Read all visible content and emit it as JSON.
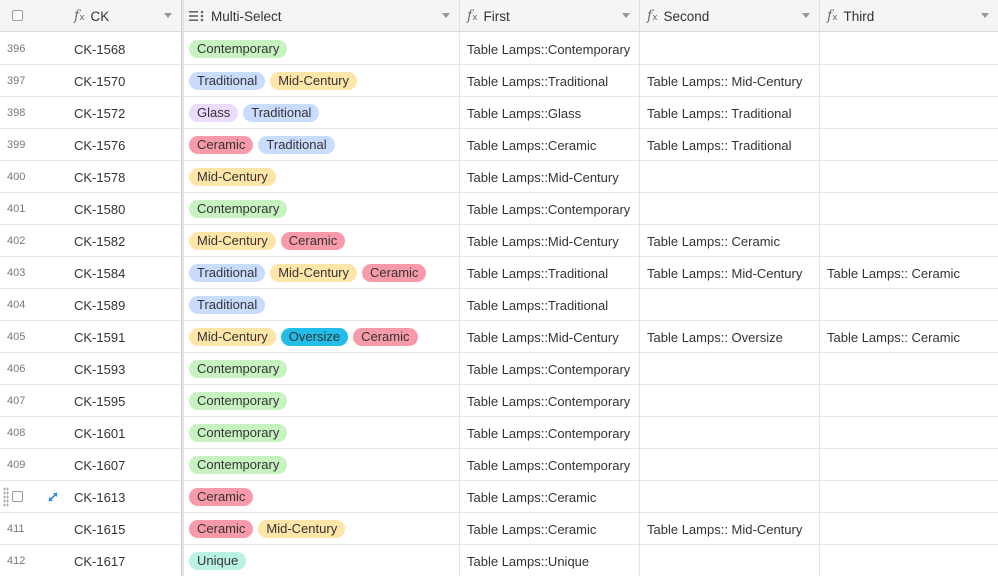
{
  "colors": {
    "Contemporary": "#c7f3c1",
    "Traditional": "#c9dcff",
    "Mid-Century": "#ffe5a8",
    "Glass": "#eadbff",
    "Ceramic": "#f99aab",
    "Oversize": "#22bde8",
    "Unique": "#b9f2e2"
  },
  "columns": [
    {
      "label": "CK",
      "icon": "formula-icon"
    },
    {
      "label": "Multi-Select",
      "icon": "multi-select-icon"
    },
    {
      "label": "First",
      "icon": "formula-icon"
    },
    {
      "label": "Second",
      "icon": "formula-icon"
    },
    {
      "label": "Third",
      "icon": "formula-icon"
    }
  ],
  "rows": [
    {
      "num": "396",
      "ck": "CK-1568",
      "tags": [
        "Contemporary"
      ],
      "first": "Table Lamps::Contemporary",
      "second": "",
      "third": ""
    },
    {
      "num": "397",
      "ck": "CK-1570",
      "tags": [
        "Traditional",
        "Mid-Century"
      ],
      "first": "Table Lamps::Traditional",
      "second": "Table Lamps:: Mid-Century",
      "third": ""
    },
    {
      "num": "398",
      "ck": "CK-1572",
      "tags": [
        "Glass",
        "Traditional"
      ],
      "first": "Table Lamps::Glass",
      "second": "Table Lamps:: Traditional",
      "third": ""
    },
    {
      "num": "399",
      "ck": "CK-1576",
      "tags": [
        "Ceramic",
        "Traditional"
      ],
      "first": "Table Lamps::Ceramic",
      "second": "Table Lamps:: Traditional",
      "third": ""
    },
    {
      "num": "400",
      "ck": "CK-1578",
      "tags": [
        "Mid-Century"
      ],
      "first": "Table Lamps::Mid-Century",
      "second": "",
      "third": ""
    },
    {
      "num": "401",
      "ck": "CK-1580",
      "tags": [
        "Contemporary"
      ],
      "first": "Table Lamps::Contemporary",
      "second": "",
      "third": ""
    },
    {
      "num": "402",
      "ck": "CK-1582",
      "tags": [
        "Mid-Century",
        "Ceramic"
      ],
      "first": "Table Lamps::Mid-Century",
      "second": "Table Lamps:: Ceramic",
      "third": ""
    },
    {
      "num": "403",
      "ck": "CK-1584",
      "tags": [
        "Traditional",
        "Mid-Century",
        "Ceramic"
      ],
      "first": "Table Lamps::Traditional",
      "second": "Table Lamps:: Mid-Century",
      "third": "Table Lamps:: Ceramic"
    },
    {
      "num": "404",
      "ck": "CK-1589",
      "tags": [
        "Traditional"
      ],
      "first": "Table Lamps::Traditional",
      "second": "",
      "third": ""
    },
    {
      "num": "405",
      "ck": "CK-1591",
      "tags": [
        "Mid-Century",
        "Oversize",
        "Ceramic"
      ],
      "first": "Table Lamps::Mid-Century",
      "second": "Table Lamps:: Oversize",
      "third": "Table Lamps:: Ceramic"
    },
    {
      "num": "406",
      "ck": "CK-1593",
      "tags": [
        "Contemporary"
      ],
      "first": "Table Lamps::Contemporary",
      "second": "",
      "third": ""
    },
    {
      "num": "407",
      "ck": "CK-1595",
      "tags": [
        "Contemporary"
      ],
      "first": "Table Lamps::Contemporary",
      "second": "",
      "third": ""
    },
    {
      "num": "408",
      "ck": "CK-1601",
      "tags": [
        "Contemporary"
      ],
      "first": "Table Lamps::Contemporary",
      "second": "",
      "third": ""
    },
    {
      "num": "409",
      "ck": "CK-1607",
      "tags": [
        "Contemporary"
      ],
      "first": "Table Lamps::Contemporary",
      "second": "",
      "third": ""
    },
    {
      "num": "",
      "ck": "CK-1613",
      "tags": [
        "Ceramic"
      ],
      "first": "Table Lamps::Ceramic",
      "second": "",
      "third": "",
      "hovered": true
    },
    {
      "num": "411",
      "ck": "CK-1615",
      "tags": [
        "Ceramic",
        "Mid-Century"
      ],
      "first": "Table Lamps::Ceramic",
      "second": "Table Lamps:: Mid-Century",
      "third": ""
    },
    {
      "num": "412",
      "ck": "CK-1617",
      "tags": [
        "Unique"
      ],
      "first": "Table Lamps::Unique",
      "second": "",
      "third": ""
    }
  ]
}
